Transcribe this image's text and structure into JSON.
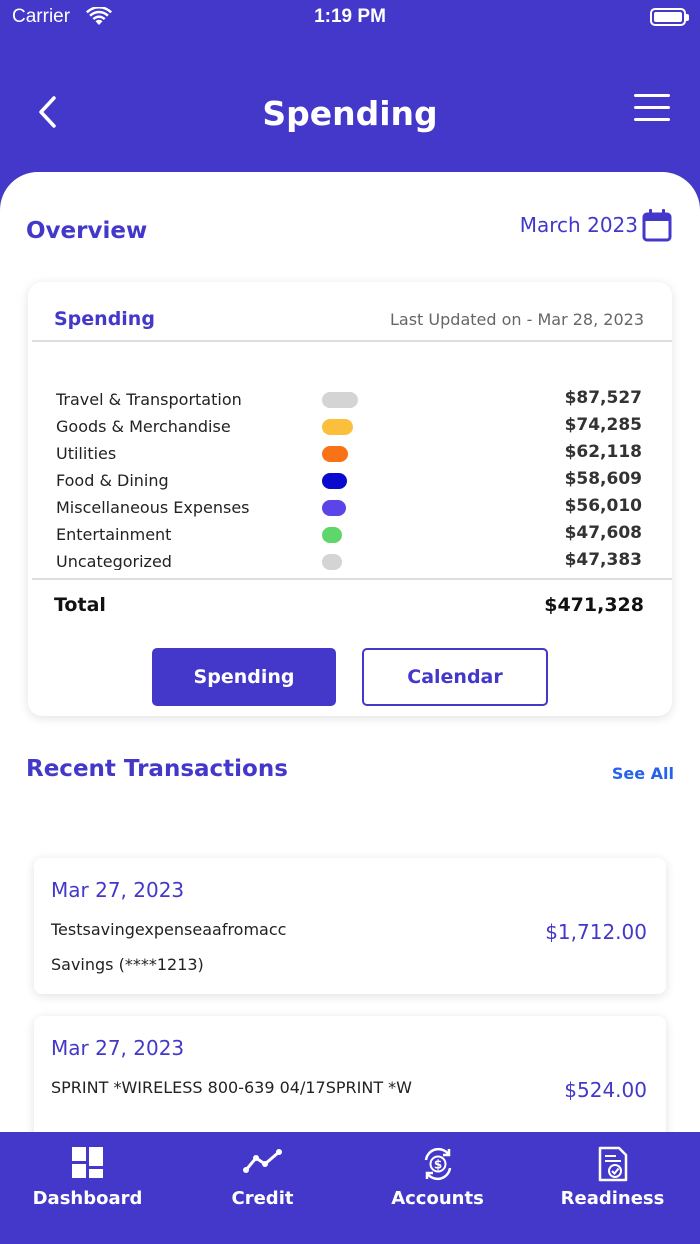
{
  "status_bar": {
    "carrier": "Carrier",
    "time": "1:19 PM"
  },
  "header": {
    "title": "Spending",
    "back_icon": "chevron-left-icon",
    "menu_icon": "hamburger-menu-icon"
  },
  "overview": {
    "title": "Overview",
    "month": "March 2023",
    "calendar_icon": "calendar-icon"
  },
  "spending_card": {
    "title": "Spending",
    "last_updated": "Last Updated on - Mar 28, 2023",
    "categories": [
      {
        "name": "Travel & Transportation",
        "color": "#D4D4D4",
        "amount": "$87,527"
      },
      {
        "name": "Goods & Merchandise",
        "color": "#FBBF3C",
        "amount": "$74,285"
      },
      {
        "name": "Utilities",
        "color": "#F97316",
        "amount": "$62,118"
      },
      {
        "name": "Food & Dining",
        "color": "#0A0ACF",
        "amount": "$58,609"
      },
      {
        "name": "Miscellaneous Expenses",
        "color": "#5B45E8",
        "amount": "$56,010"
      },
      {
        "name": "Entertainment",
        "color": "#5FD66A",
        "amount": "$47,608"
      },
      {
        "name": "Uncategorized",
        "color": "#D4D4D4",
        "amount": "$47,383"
      }
    ],
    "total_label": "Total",
    "total_value": "$471,328",
    "buttons": {
      "spending": "Spending",
      "calendar": "Calendar"
    }
  },
  "recent": {
    "title": "Recent Transactions",
    "see_all": "See All",
    "transactions": [
      {
        "date": "Mar 27, 2023",
        "description": "Testsavingexpenseaafromacc",
        "account": "Savings (****1213)",
        "amount": "$1,712.00"
      },
      {
        "date": "Mar 27, 2023",
        "description": "SPRINT *WIRELESS 800-639 04/17SPRINT *W",
        "account": "",
        "amount": "$524.00"
      }
    ]
  },
  "tabbar": {
    "tabs": [
      {
        "label": "Dashboard",
        "icon": "dashboard-icon"
      },
      {
        "label": "Credit",
        "icon": "trend-line-icon"
      },
      {
        "label": "Accounts",
        "icon": "currency-exchange-icon"
      },
      {
        "label": "Readiness",
        "icon": "document-check-icon"
      }
    ]
  },
  "colors": {
    "primary": "#4338CA",
    "link": "#2563EB"
  }
}
